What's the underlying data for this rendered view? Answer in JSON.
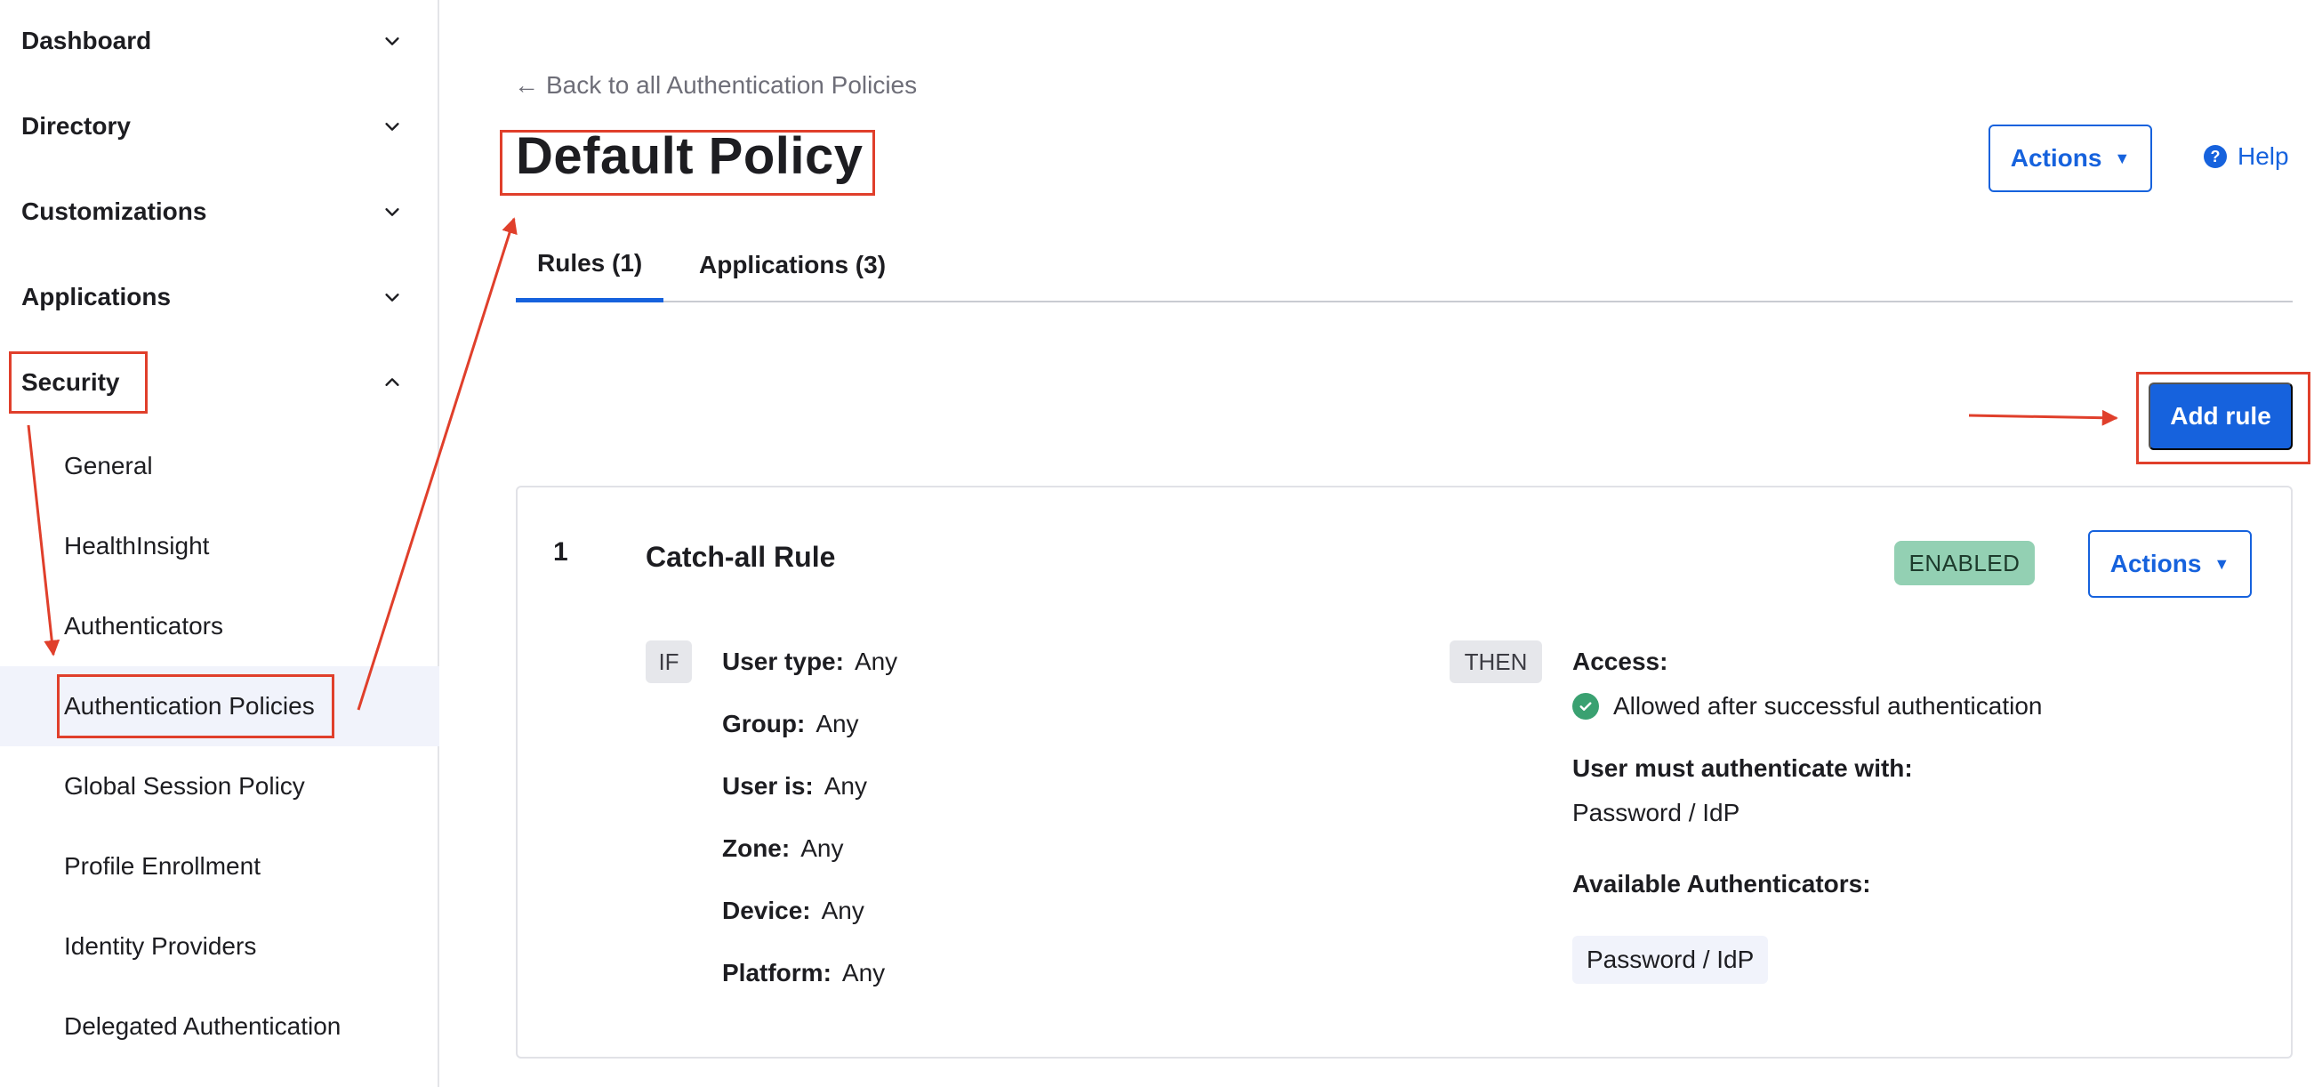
{
  "sidebar": {
    "groups": [
      {
        "label": "Dashboard",
        "expanded": false
      },
      {
        "label": "Directory",
        "expanded": false
      },
      {
        "label": "Customizations",
        "expanded": false
      },
      {
        "label": "Applications",
        "expanded": false
      },
      {
        "label": "Security",
        "expanded": true
      }
    ],
    "security_items": [
      {
        "label": "General"
      },
      {
        "label": "HealthInsight"
      },
      {
        "label": "Authenticators"
      },
      {
        "label": "Authentication Policies",
        "active": true
      },
      {
        "label": "Global Session Policy"
      },
      {
        "label": "Profile Enrollment"
      },
      {
        "label": "Identity Providers"
      },
      {
        "label": "Delegated Authentication"
      }
    ]
  },
  "header": {
    "back_link": "Back to all Authentication Policies",
    "title": "Default Policy",
    "actions_label": "Actions",
    "help_label": "Help"
  },
  "tabs": [
    {
      "label": "Rules (1)",
      "active": true
    },
    {
      "label": "Applications (3)",
      "active": false
    }
  ],
  "add_rule_label": "Add rule",
  "rule": {
    "number": "1",
    "name": "Catch-all Rule",
    "status": "ENABLED",
    "actions_label": "Actions",
    "if_label": "IF",
    "then_label": "THEN",
    "conditions": [
      {
        "key": "User type:",
        "value": "Any"
      },
      {
        "key": "Group:",
        "value": "Any"
      },
      {
        "key": "User is:",
        "value": "Any"
      },
      {
        "key": "Zone:",
        "value": "Any"
      },
      {
        "key": "Device:",
        "value": "Any"
      },
      {
        "key": "Platform:",
        "value": "Any"
      }
    ],
    "access_label": "Access:",
    "access_value": "Allowed after successful authentication",
    "must_auth_label": "User must authenticate with:",
    "must_auth_value": "Password / IdP",
    "available_label": "Available Authenticators:",
    "available_value": "Password / IdP"
  },
  "colors": {
    "accent": "#1662dd",
    "annotation": "#e03f2b",
    "enabled_badge": "#93d0b3",
    "success": "#3aa171"
  }
}
